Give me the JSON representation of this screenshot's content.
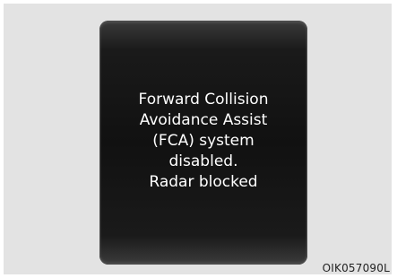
{
  "display": {
    "message_lines": [
      "Forward Collision",
      "Avoidance Assist",
      "(FCA) system",
      "disabled.",
      "Radar blocked"
    ]
  },
  "figure_code": "OIK057090L"
}
